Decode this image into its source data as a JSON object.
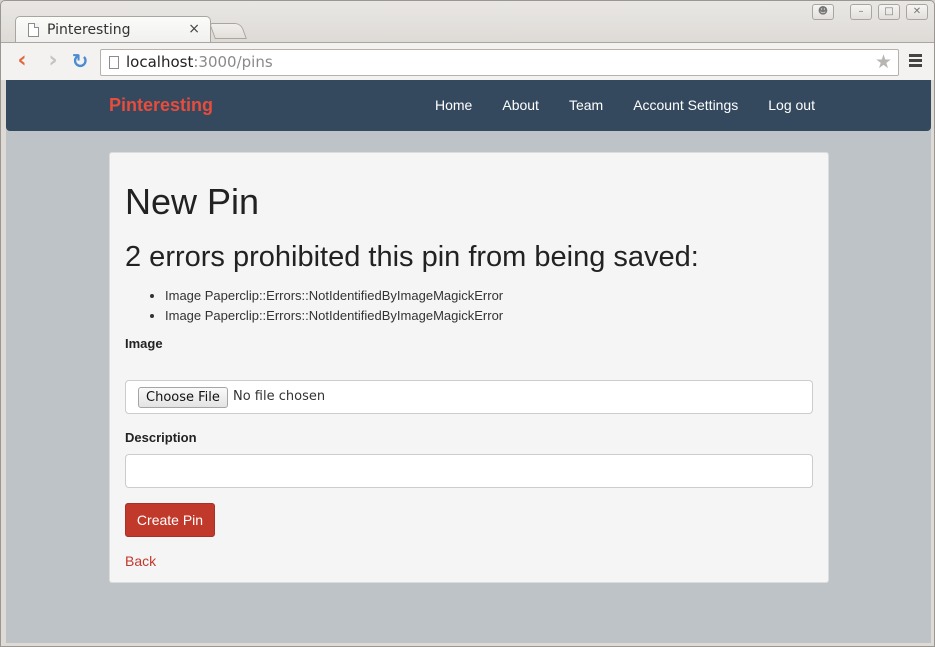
{
  "browser": {
    "tab_title": "Pinteresting",
    "tab_close": "×",
    "url_host": "localhost",
    "url_rest": ":3000/pins",
    "icons": [
      "page-icon",
      "close-icon",
      "back-arrow-icon",
      "forward-arrow-icon",
      "reload-icon",
      "star-icon",
      "menu-icon",
      "profile-icon",
      "minimize-icon",
      "maximize-icon",
      "window-close-icon"
    ]
  },
  "navbar": {
    "brand": "Pinteresting",
    "links": [
      "Home",
      "About",
      "Team",
      "Account Settings",
      "Log out"
    ]
  },
  "form": {
    "title": "New Pin",
    "error_heading": "2 errors prohibited this pin from being saved:",
    "errors": [
      "Image Paperclip::Errors::NotIdentifiedByImageMagickError",
      "Image Paperclip::Errors::NotIdentifiedByImageMagickError"
    ],
    "image_label": "Image",
    "choose_file": "Choose File",
    "no_file": "No file chosen",
    "description_label": "Description",
    "description_value": "",
    "submit": "Create Pin",
    "back": "Back"
  },
  "colors": {
    "navbar": "#34495e",
    "brand": "#e74c3c",
    "button": "#c0392b",
    "background": "#bdc3c7"
  }
}
